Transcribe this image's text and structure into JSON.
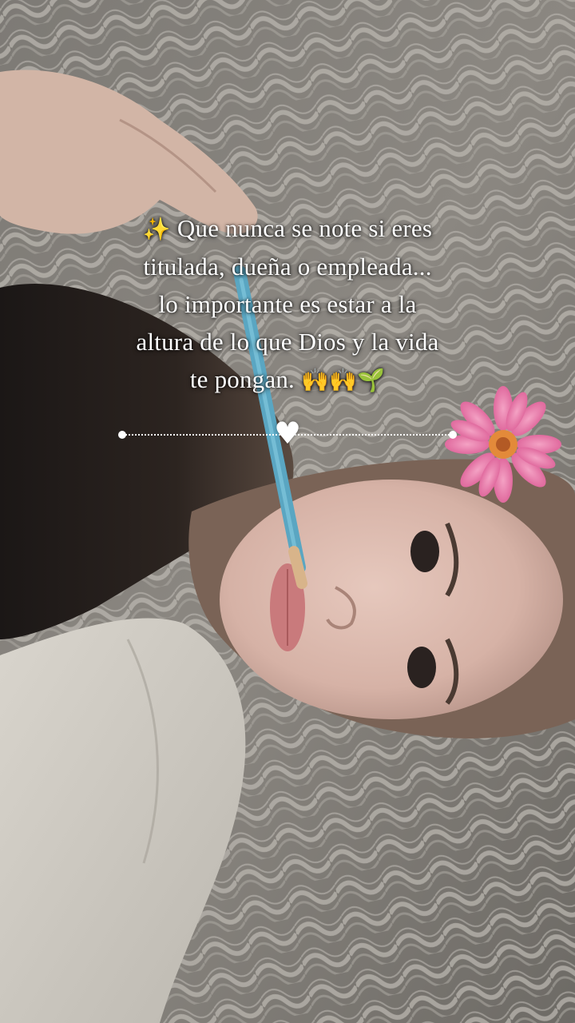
{
  "quote": {
    "line1_emoji": "✨",
    "line1_text": "Que nunca se note si eres",
    "line2": "titulada, dueña o empleada...",
    "line3": "lo importante es estar a la",
    "line4": "altura de lo que Dios y la vida",
    "line5_text": "te pongan.",
    "line5_emoji_hands": "🙌🙌",
    "line5_emoji_sprout": "🌱"
  },
  "divider": {
    "heart": "♥"
  },
  "colors": {
    "text": "#ffffff",
    "flower": "#e66aa1",
    "flower_center": "#e38a3a"
  }
}
